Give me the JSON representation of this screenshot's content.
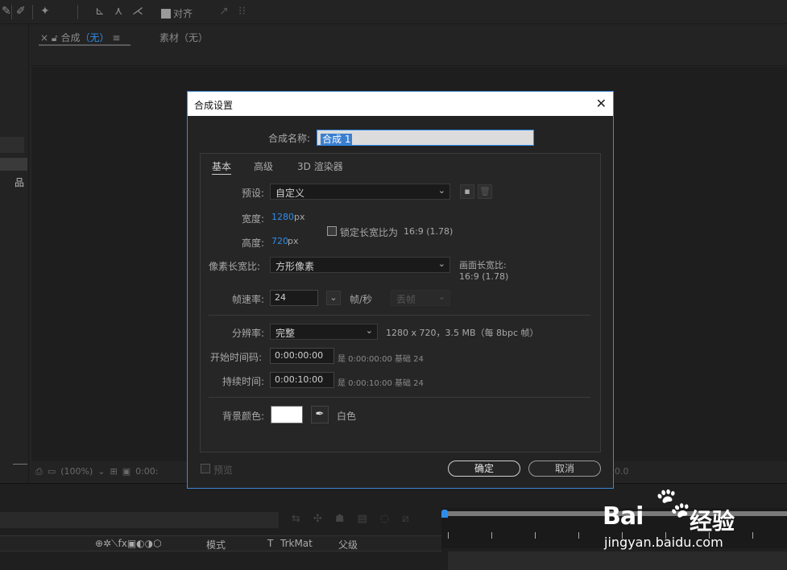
{
  "toolbar": {
    "align_label": "对齐"
  },
  "comp_panel": {
    "tab_comp_prefix": "合成",
    "tab_comp_value": "（无）",
    "tab_material": "素材（无）",
    "zoom_label": "(100%)",
    "time_fragment": "0:00:",
    "right_time_fragment": "0.0"
  },
  "timeline": {
    "col_mode": "模式",
    "col_t": "T",
    "col_trkmat": "TrkMat",
    "col_parent": "父级"
  },
  "dialog": {
    "title": "合成设置",
    "close_icon": "✕",
    "name_label": "合成名称:",
    "name_value": "合成 1",
    "tabs": [
      "基本",
      "高级",
      "3D 渲染器"
    ],
    "preset_label": "预设:",
    "preset_value": "自定义",
    "width_label": "宽度:",
    "width_value": "1280",
    "width_unit": "px",
    "height_label": "高度:",
    "height_value": "720",
    "height_unit": "px",
    "lock_aspect_label": "锁定长宽比为",
    "lock_aspect_value": "16:9 (1.78)",
    "pixel_aspect_label": "像素长宽比:",
    "pixel_aspect_value": "方形像素",
    "frame_aspect_label": "画面长宽比:",
    "frame_aspect_value": "16:9 (1.78)",
    "framerate_label": "帧速率:",
    "framerate_value": "24",
    "framerate_unit": "帧/秒",
    "drop_frame_value": "丢帧",
    "resolution_label": "分辨率:",
    "resolution_value": "完整",
    "resolution_info": "1280 x 720，3.5 MB（每 8bpc 帧）",
    "start_tc_label": "开始时间码:",
    "start_tc_value": "0:00:00:00",
    "start_tc_info": "是 0:00:00:00  基础 24",
    "duration_label": "持续时间:",
    "duration_value": "0:00:10:00",
    "duration_info": "是 0:00:10:00  基础 24",
    "bgcolor_label": "背景颜色:",
    "bgcolor_name": "白色",
    "bgcolor_hex": "#ffffff",
    "preview_label": "预览",
    "ok_label": "确定",
    "cancel_label": "取消"
  },
  "watermark": {
    "brand": "Bai",
    "brand_cn": "经验",
    "url": "jingyan.baidu.com"
  },
  "colors": {
    "accent": "#2d8ceb",
    "bg": "#232323",
    "dialog_border": "#3e88d6"
  }
}
